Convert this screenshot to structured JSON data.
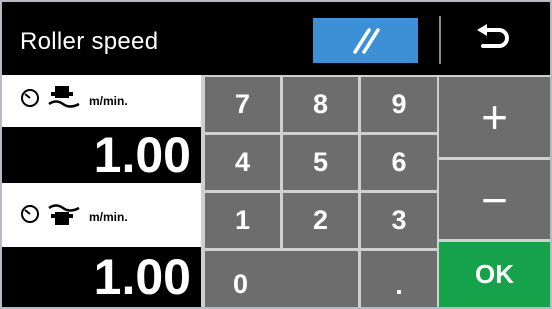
{
  "header": {
    "title": "Roller speed",
    "mode_icon": "double-slash-icon",
    "back_icon": "return-arrow-icon"
  },
  "displays": [
    {
      "unit": "m/min.",
      "value": "1.00",
      "timer_icon": "timer-icon",
      "mode_icon": "roller-bottom-icon"
    },
    {
      "unit": "m/min.",
      "value": "1.00",
      "timer_icon": "timer-icon",
      "mode_icon": "roller-top-icon"
    }
  ],
  "keypad": {
    "keys": [
      "7",
      "8",
      "9",
      "4",
      "5",
      "6",
      "1",
      "2",
      "3",
      "0",
      "."
    ]
  },
  "controls": {
    "plus": "+",
    "minus": "−",
    "ok": "OK"
  },
  "colors": {
    "header_bg": "#000000",
    "mode_button": "#3d8fd6",
    "key_bg": "#6d6d6d",
    "ok_bg": "#16a24b"
  }
}
